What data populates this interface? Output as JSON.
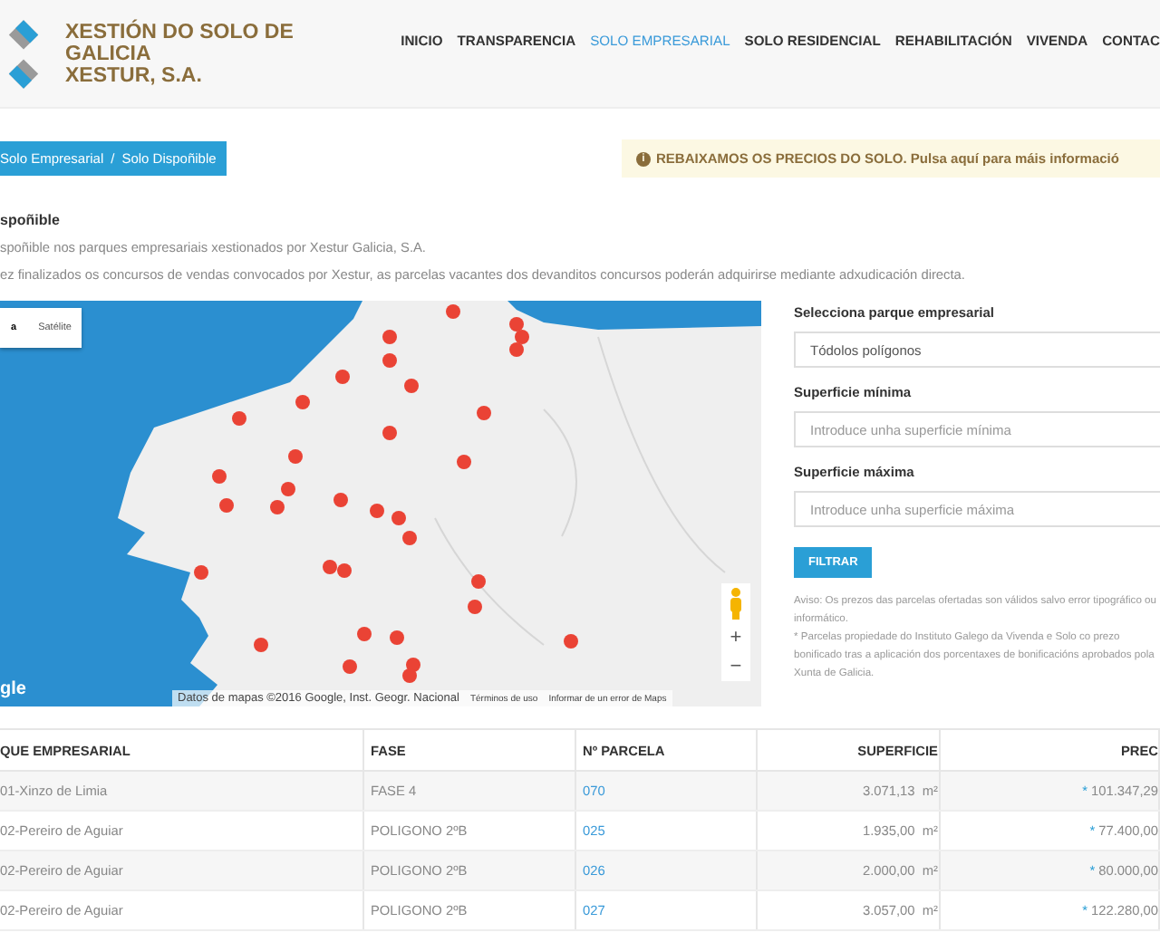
{
  "header": {
    "title_lines": [
      "XESTIÓN DO SOLO DE GALICIA",
      "XESTUR, S.A."
    ],
    "nav": [
      {
        "label": "INICIO",
        "selected": false
      },
      {
        "label": "TRANSPARENCIA",
        "selected": false
      },
      {
        "label": "SOLO EMPRESARIAL",
        "selected": true
      },
      {
        "label": "SOLO RESIDENCIAL",
        "selected": false
      },
      {
        "label": "REHABILITACIÓN",
        "selected": false
      },
      {
        "label": "VIVENDA",
        "selected": false
      },
      {
        "label": "CONTAC",
        "selected": false
      }
    ]
  },
  "breadcrumb": {
    "items": [
      "Solo Empresarial",
      "Solo Dispoñible"
    ],
    "separator": "/"
  },
  "notice": {
    "icon": "i",
    "text": "REBAIXAMOS OS PRECIOS DO SOLO. Pulsa aquí para máis informació"
  },
  "heading": "spoñible",
  "paragraphs": [
    "spoñible nos parques empresariais xestionados por Xestur Galicia, S.A.",
    "ez finalizados os concursos de vendas convocados por Xestur, as parcelas vacantes dos devanditos concursos poderán adquirirse mediante adxudicación directa."
  ],
  "map": {
    "types": [
      {
        "label": "a",
        "selected": true
      },
      {
        "label": "Satélite",
        "selected": false
      }
    ],
    "logo": "gle",
    "zoom_in": "+",
    "zoom_out": "−",
    "attribution": "Datos de mapas ©2016 Google, Inst. Geogr. Nacional",
    "terms": "Términos de uso",
    "report": "Informar de un error de Maps"
  },
  "form": {
    "park_label": "Selecciona parque empresarial",
    "park_value": "Tódolos polígonos",
    "min_label": "Superficie mínima",
    "min_placeholder": "Introduce unha superficie mínima",
    "max_label": "Superficie máxima",
    "max_placeholder": "Introduce unha superficie máxima",
    "button": "FILTRAR",
    "notes": [
      "Aviso: Os prezos das parcelas ofertadas son válidos salvo error tipográfico ou informático.",
      "* Parcelas propiedade do Instituto Galego da Vivenda e Solo co prezo bonificado tras a aplicación dos porcentaxes de bonificacións aprobados pola Xunta de Galicia."
    ]
  },
  "table": {
    "columns": [
      "QUE EMPRESARIAL",
      "FASE",
      "Nº PARCELA",
      "SUPERFICIE",
      "PREC"
    ],
    "rows": [
      {
        "park": "01-Xinzo de Limia",
        "phase": "FASE 4",
        "parcel": "070",
        "area": "3.071,13",
        "unit": "m²",
        "mark": "*",
        "price": "101.347,29"
      },
      {
        "park": "02-Pereiro de Aguiar",
        "phase": "POLIGONO 2ºB",
        "parcel": "025",
        "area": "1.935,00",
        "unit": "m²",
        "mark": "*",
        "price": "77.400,00"
      },
      {
        "park": "02-Pereiro de Aguiar",
        "phase": "POLIGONO 2ºB",
        "parcel": "026",
        "area": "2.000,00",
        "unit": "m²",
        "mark": "*",
        "price": "80.000,00"
      },
      {
        "park": "02-Pereiro de Aguiar",
        "phase": "POLIGONO 2ºB",
        "parcel": "027",
        "area": "3.057,00",
        "unit": "m²",
        "mark": "*",
        "price": "122.280,00"
      }
    ]
  }
}
